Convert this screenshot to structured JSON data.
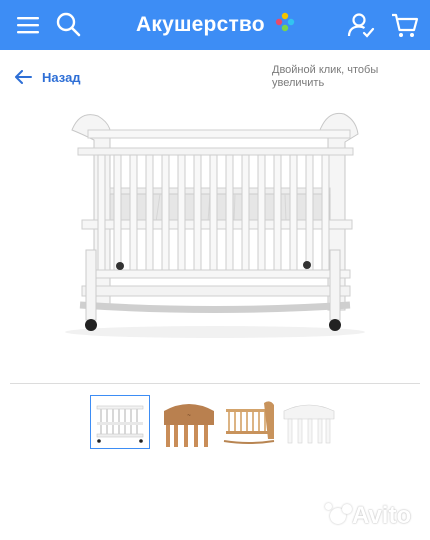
{
  "header": {
    "logo_text": "Акушерство",
    "menu_icon": "hamburger-menu-icon",
    "search_icon": "search-icon",
    "profile_icon": "user-check-icon",
    "cart_icon": "cart-icon",
    "background_color": "#3d8df5",
    "logo_dot_colors": [
      "#f5c400",
      "#e94b6b",
      "#32c4f0",
      "#7bd44a"
    ]
  },
  "nav": {
    "back_label": "Назад",
    "zoom_hint": "Двойной клик, чтобы увеличить",
    "accent_color": "#2e6fd6"
  },
  "gallery": {
    "main_image": "white-wooden-baby-crib-photo",
    "thumbnails": [
      {
        "name": "white-crib-thumb",
        "active": true
      },
      {
        "name": "natural-crib-headboard-thumb",
        "active": false
      },
      {
        "name": "natural-crib-rocker-thumb",
        "active": false
      },
      {
        "name": "white-crib-headboard-thumb",
        "active": false
      }
    ]
  },
  "watermark": {
    "text": "Avito"
  }
}
